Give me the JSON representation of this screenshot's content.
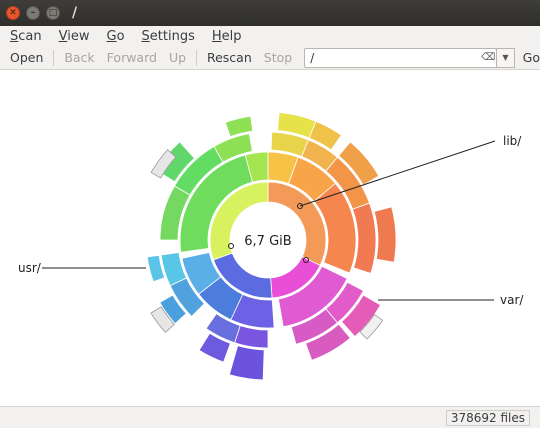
{
  "window": {
    "title": "/"
  },
  "menu": [
    "Scan",
    "View",
    "Go",
    "Settings",
    "Help"
  ],
  "toolbar": {
    "open": "Open",
    "back": "Back",
    "forward": "Forward",
    "up": "Up",
    "rescan": "Rescan",
    "stop": "Stop",
    "location_value": "/",
    "go": "Go"
  },
  "chart": {
    "total": "6,7 GiB",
    "labels": {
      "lib": "lib/",
      "usr": "usr/",
      "var": "var/"
    }
  },
  "status": {
    "files": "378692 files"
  }
}
